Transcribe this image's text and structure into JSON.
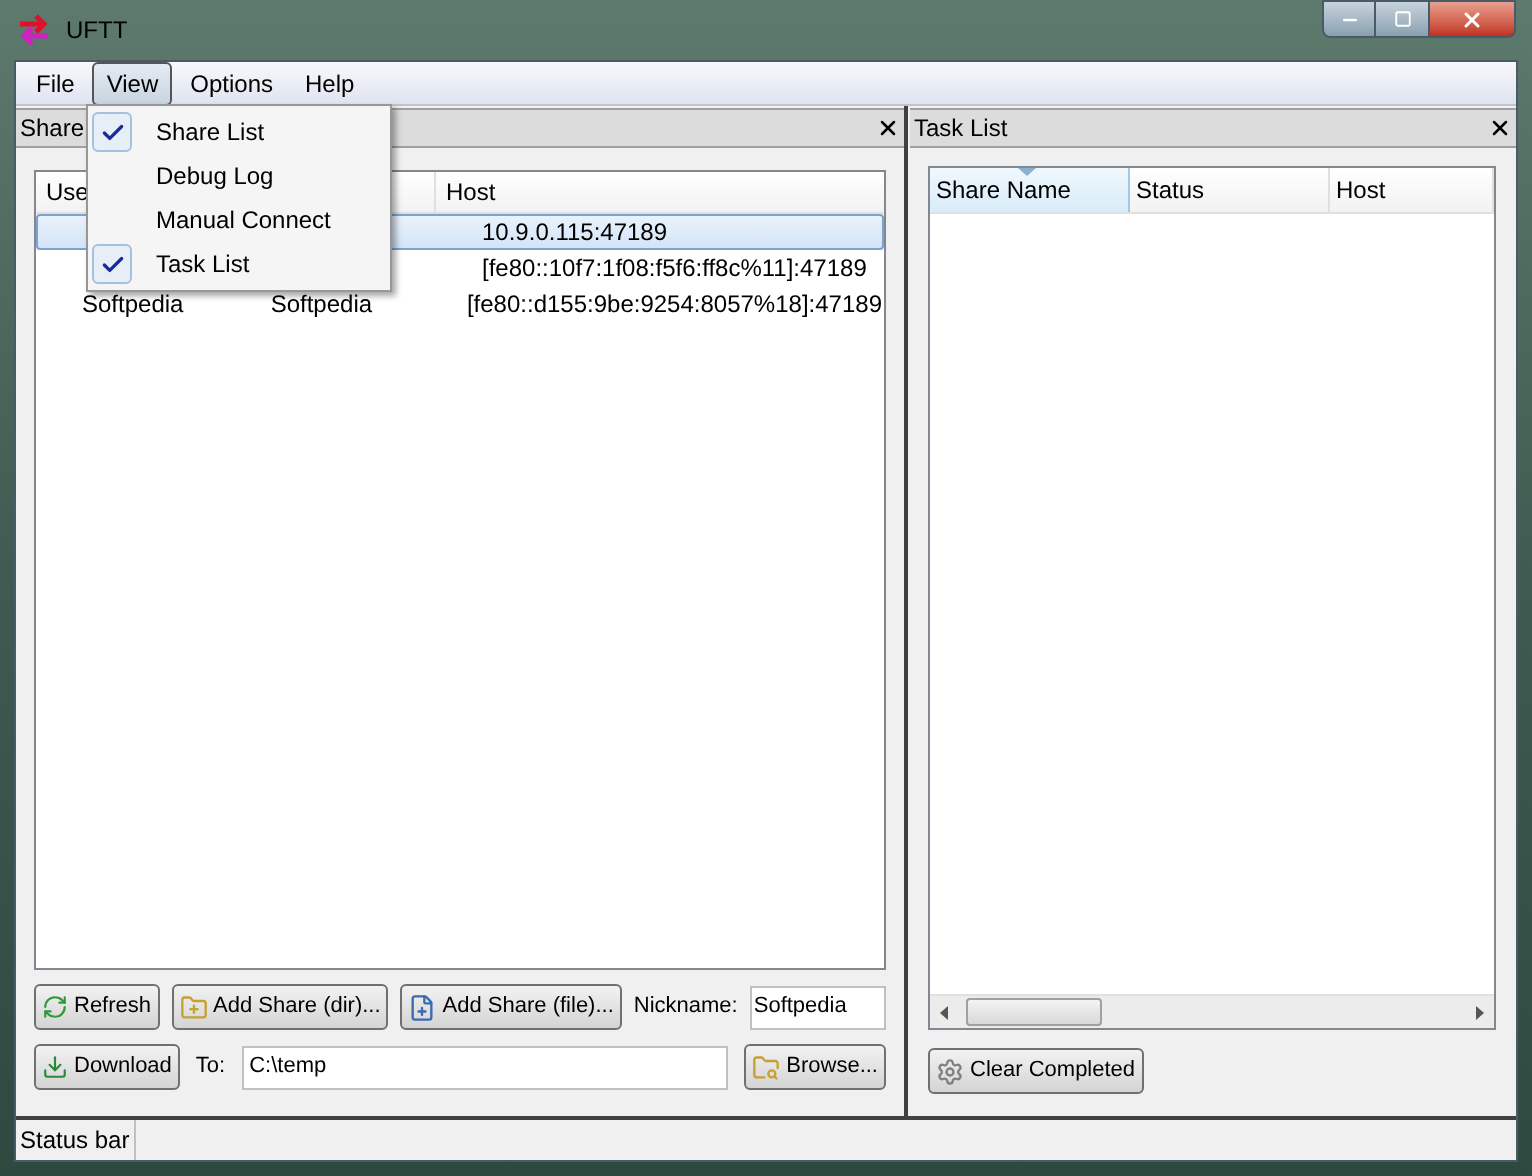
{
  "window": {
    "title": "UFTT"
  },
  "menu_bar": [
    {
      "label": "File",
      "selected": false
    },
    {
      "label": "View",
      "selected": true
    },
    {
      "label": "Options",
      "selected": false
    },
    {
      "label": "Help",
      "selected": false
    }
  ],
  "view_menu": [
    {
      "label": "Share List",
      "checked": true
    },
    {
      "label": "Debug Log",
      "checked": false
    },
    {
      "label": "Manual Connect",
      "checked": false
    },
    {
      "label": "Task List",
      "checked": true
    }
  ],
  "share_pane": {
    "title": "Share",
    "columns": {
      "column_1": "Use",
      "host": "Host"
    },
    "rows": [
      {
        "host": "10.9.0.115:47189",
        "selected": true
      },
      {
        "host": "[fe80::10f7:1f08:f5f6:ff8c%11]:47189",
        "selected": false
      },
      {
        "column_1": "Softpedia",
        "column_2": "Softpedia",
        "host": "[fe80::d155:9be:9254:8057%18]:47189",
        "selected": false
      }
    ],
    "refresh": "Refresh",
    "add_dir": "Add Share (dir)...",
    "add_file": "Add Share (file)...",
    "nickname_label": "Nickname:",
    "nickname": "Softpedia",
    "download": "Download",
    "to_label": "To:",
    "to_path": "C:\\temp",
    "browse": "Browse..."
  },
  "task_pane": {
    "title": "Task List",
    "columns": [
      {
        "label": "Share Name",
        "sorted": true
      },
      {
        "label": "Status",
        "sorted": false
      },
      {
        "label": "Host",
        "sorted": false
      }
    ],
    "clear": "Clear Completed"
  },
  "status_bar": "Status bar"
}
